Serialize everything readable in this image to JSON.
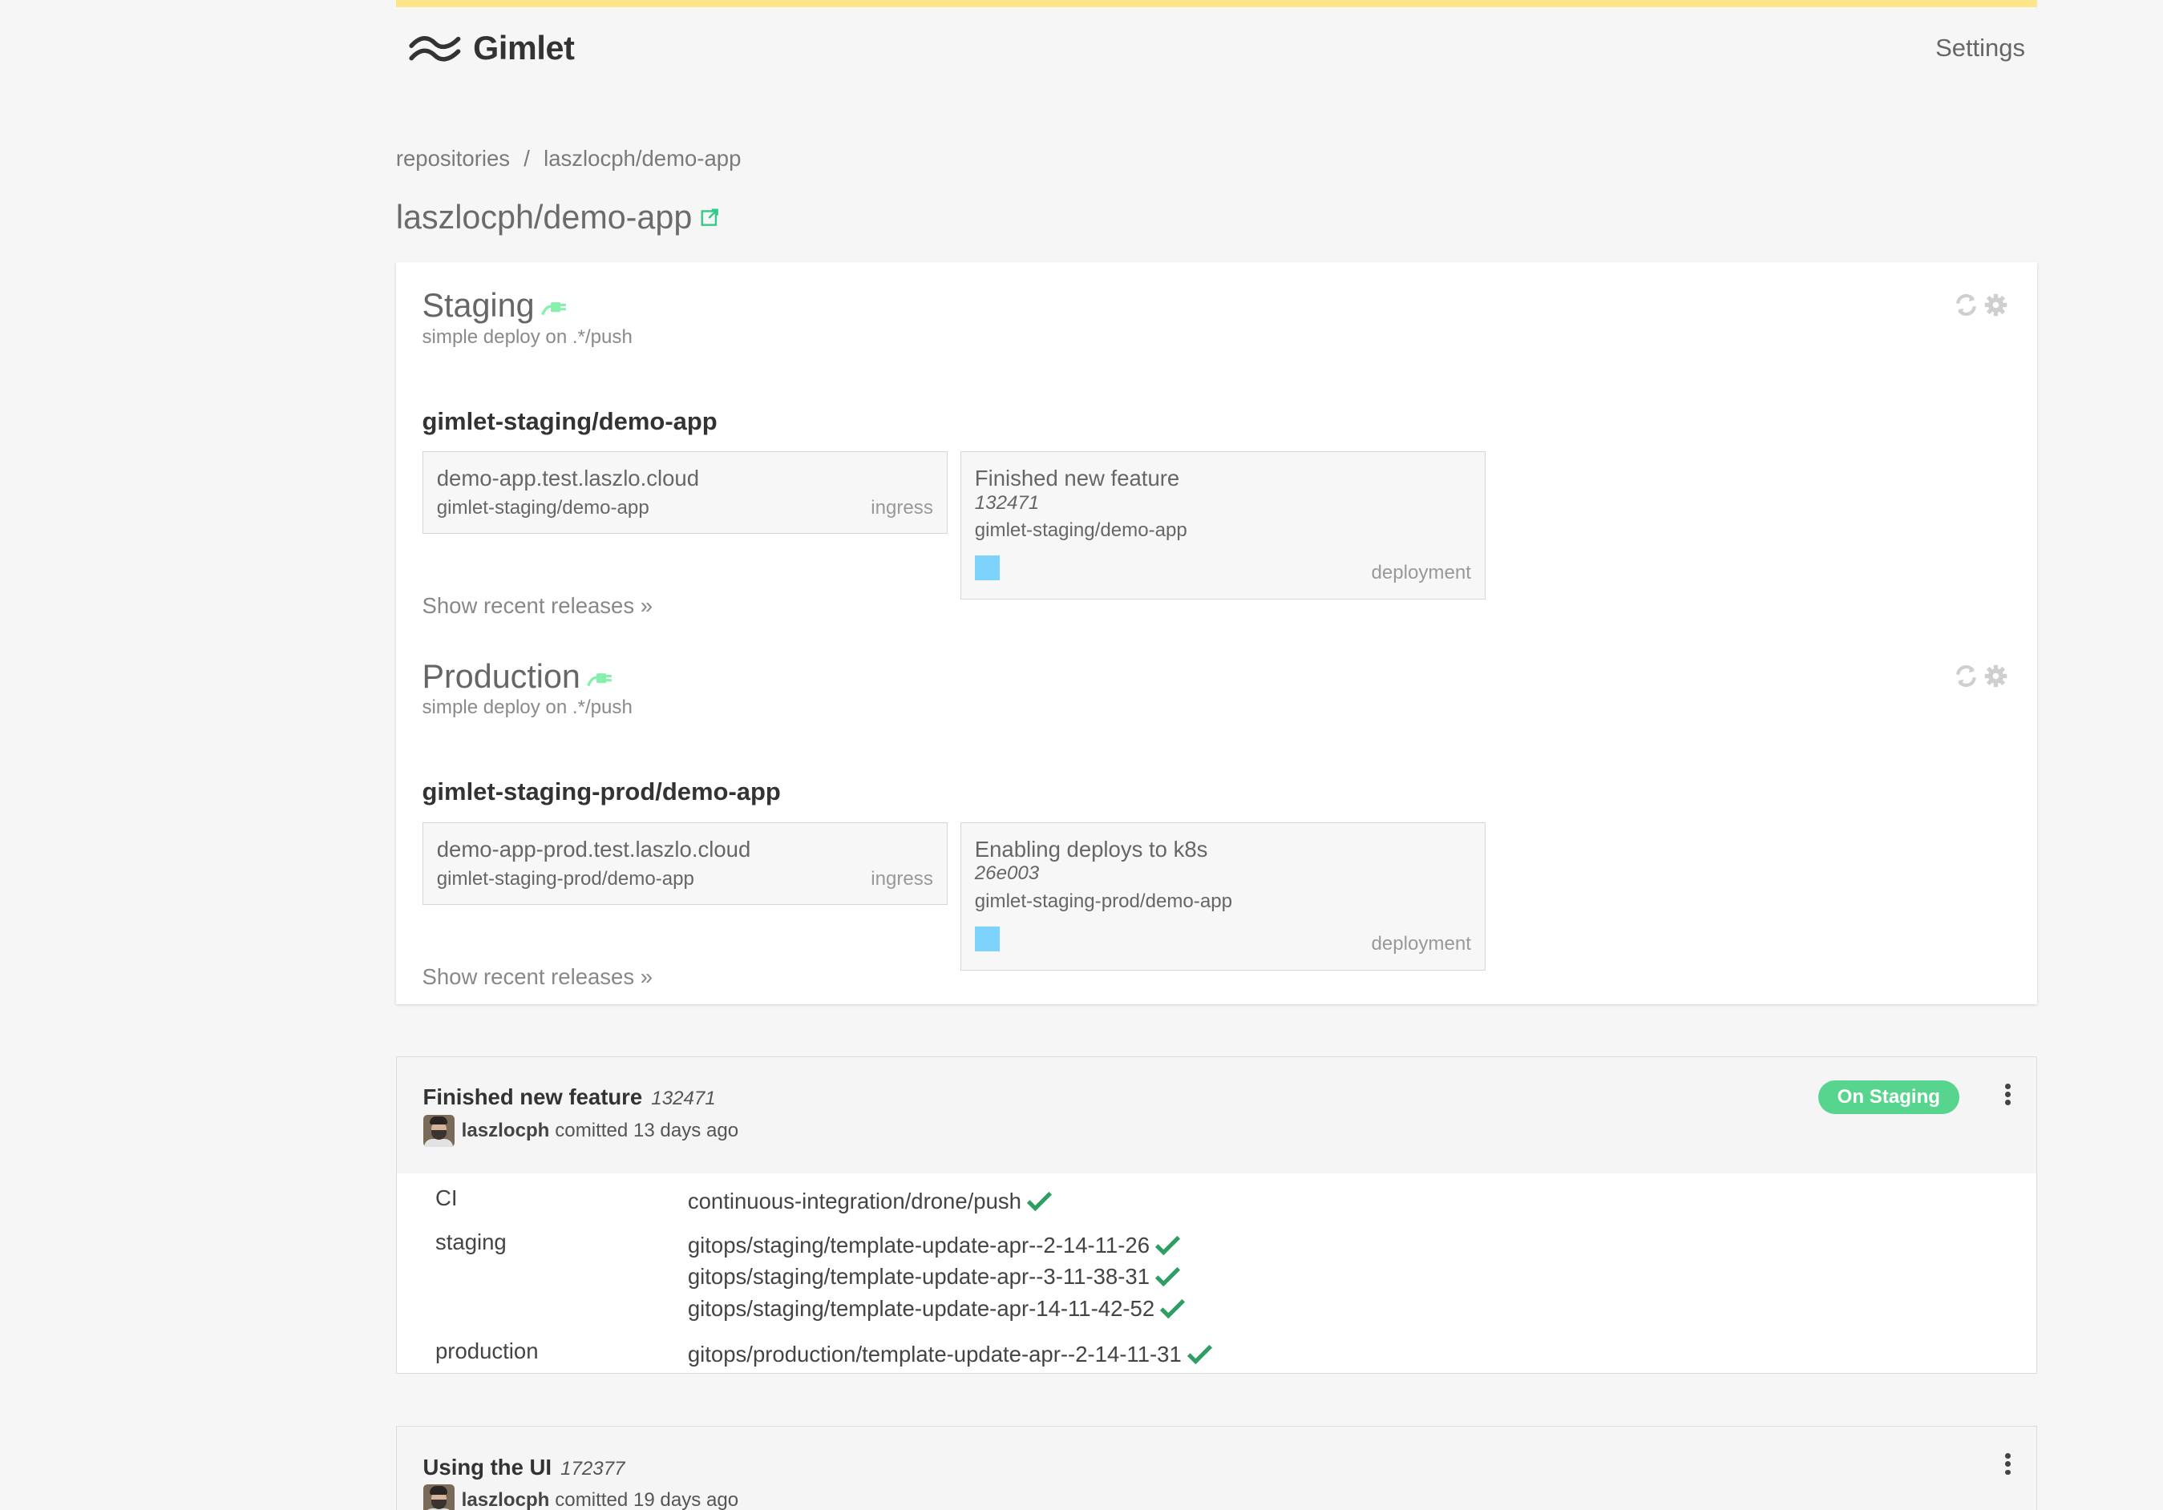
{
  "app": {
    "name": "Gimlet",
    "settings_label": "Settings"
  },
  "breadcrumb": {
    "root": "repositories",
    "separator": "/",
    "current": "laszlocph/demo-app"
  },
  "repo_title": "laszlocph/demo-app",
  "environments": [
    {
      "name": "Staging",
      "subtitle": "simple deploy on .*/push",
      "app_title": "gimlet-staging/demo-app",
      "ingress": {
        "host": "demo-app.test.laszlo.cloud",
        "namespace_app": "gimlet-staging/demo-app",
        "kind": "ingress"
      },
      "deployment": {
        "message": "Finished new feature",
        "sha": "132471",
        "namespace_app": "gimlet-staging/demo-app",
        "kind": "deployment"
      },
      "show_releases": "Show recent releases »"
    },
    {
      "name": "Production",
      "subtitle": "simple deploy on .*/push",
      "app_title": "gimlet-staging-prod/demo-app",
      "ingress": {
        "host": "demo-app-prod.test.laszlo.cloud",
        "namespace_app": "gimlet-staging-prod/demo-app",
        "kind": "ingress"
      },
      "deployment": {
        "message": "Enabling deploys to k8s",
        "sha": "26e003",
        "namespace_app": "gimlet-staging-prod/demo-app",
        "kind": "deployment"
      },
      "show_releases": "Show recent releases »"
    }
  ],
  "commits": [
    {
      "message": "Finished new feature",
      "sha": "132471",
      "author": "laszlocph",
      "time": "comitted 13 days ago",
      "badge": "On Staging",
      "checks": [
        {
          "label": "CI",
          "values": [
            "continuous-integration/drone/push"
          ]
        },
        {
          "label": "staging",
          "values": [
            "gitops/staging/template-update-apr--2-14-11-26",
            "gitops/staging/template-update-apr--3-11-38-31",
            "gitops/staging/template-update-apr-14-11-42-52"
          ]
        },
        {
          "label": "production",
          "values": [
            "gitops/production/template-update-apr--2-14-11-31"
          ]
        }
      ]
    },
    {
      "message": "Using the UI",
      "sha": "172377",
      "author": "laszlocph",
      "time": "comitted 19 days ago"
    }
  ],
  "colors": {
    "accent_bar": "#fde68a",
    "success": "#2f9e63",
    "badge": "#57d48d",
    "pod": "#7dd3fc",
    "env_icon": "#86efac"
  }
}
